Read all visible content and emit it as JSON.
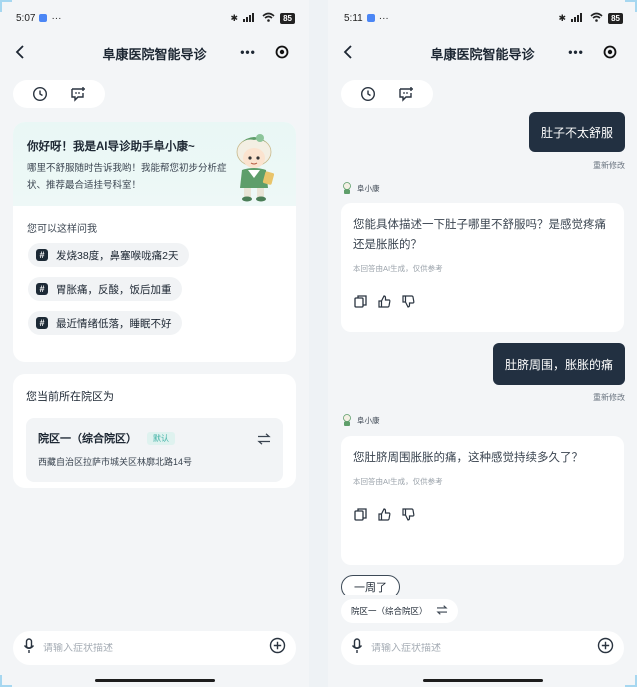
{
  "left": {
    "status": {
      "time": "5:07",
      "dots": "···",
      "battery": "85"
    },
    "nav": {
      "title": "阜康医院智能导诊"
    },
    "welcome": {
      "title": "你好呀！我是AI导诊助手阜小康~",
      "subtitle": "哪里不舒服随时告诉我哟！我能帮您初步分析症状、推荐最合适挂号科室！",
      "ask_label": "您可以这样问我",
      "suggestions": [
        "发烧38度，鼻塞喉咙痛2天",
        "胃胀痛，反酸，饭后加重",
        "最近情绪低落，睡眠不好"
      ]
    },
    "campus": {
      "label": "您当前所在院区为",
      "name": "院区一（综合院区）",
      "badge": "默认",
      "address": "西藏自治区拉萨市城关区林廓北路14号"
    },
    "input": {
      "placeholder": "请输入症状描述"
    }
  },
  "right": {
    "status": {
      "time": "5:11",
      "dots": "···",
      "battery": "85"
    },
    "nav": {
      "title": "阜康医院智能导诊"
    },
    "messages": [
      {
        "role": "user",
        "text": "肚子不太舒服",
        "edit": "重新修改"
      },
      {
        "role": "bot",
        "name": "阜小康",
        "text": "您能具体描述一下肚子哪里不舒服吗？是感觉疼痛还是胀胀的？",
        "note": "本回答由AI生成，仅供参考"
      },
      {
        "role": "user",
        "text": "肚脐周围，胀胀的痛",
        "edit": "重新修改"
      },
      {
        "role": "bot",
        "name": "阜小康",
        "text": "您肚脐周围胀胀的痛，这种感觉持续多久了？",
        "note": "本回答由AI生成，仅供参考"
      }
    ],
    "option_chip": "一周了",
    "campus_pill": "院区一（综合院区）",
    "input": {
      "placeholder": "请输入症状描述"
    }
  },
  "colors": {
    "accent_dark": "#223041",
    "teal": "#3fb1a5",
    "background": "#f3f5f7"
  },
  "icons": [
    "back-icon",
    "more-icon",
    "target-icon",
    "history-icon",
    "new-chat-icon",
    "mic-icon",
    "add-circle-icon",
    "swap-icon",
    "copy-icon",
    "thumb-up-icon",
    "thumb-down-icon"
  ]
}
